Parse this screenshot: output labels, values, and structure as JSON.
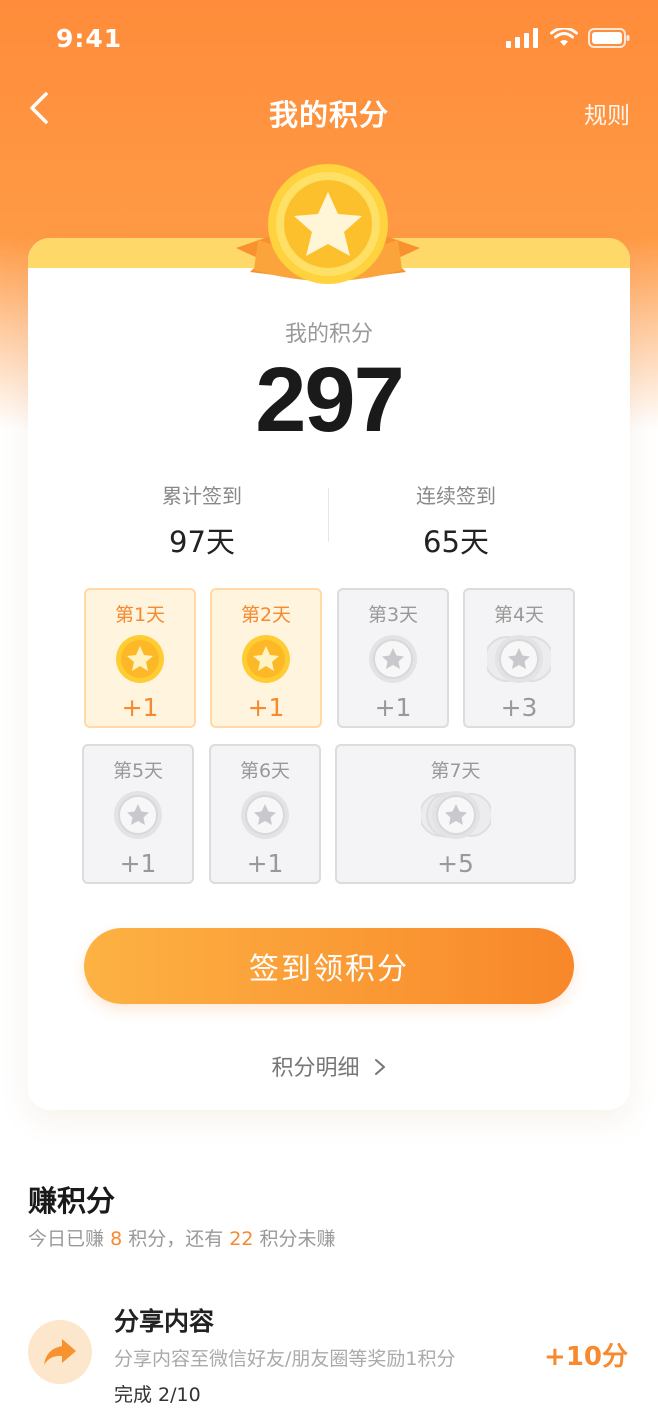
{
  "status_bar": {
    "time": "9:41"
  },
  "nav": {
    "title": "我的积分",
    "rules": "规则"
  },
  "points": {
    "label": "我的积分",
    "value": "297"
  },
  "stats": [
    {
      "label": "累计签到",
      "value": "97天"
    },
    {
      "label": "连续签到",
      "value": "65天"
    }
  ],
  "days": [
    {
      "label": "第1天",
      "bonus": "+1",
      "done": true
    },
    {
      "label": "第2天",
      "bonus": "+1",
      "done": true
    },
    {
      "label": "第3天",
      "bonus": "+1",
      "done": false
    },
    {
      "label": "第4天",
      "bonus": "+3",
      "done": false
    },
    {
      "label": "第5天",
      "bonus": "+1",
      "done": false
    },
    {
      "label": "第6天",
      "bonus": "+1",
      "done": false
    },
    {
      "label": "第7天",
      "bonus": "+5",
      "done": false
    }
  ],
  "signin_button": "签到领积分",
  "details_link": "积分明细",
  "earn": {
    "title": "赚积分",
    "sub_prefix": "今日已赚",
    "earned": "8",
    "sub_middle": "积分，还有",
    "remaining": "22",
    "sub_suffix": "积分未赚"
  },
  "task": {
    "title": "分享内容",
    "desc": "分享内容至微信好友/朋友圈等奖励1积分",
    "progress": "完成 2/10",
    "reward": "+10分",
    "icon": "share-icon"
  },
  "colors": {
    "accent": "#f7892e",
    "header": "#ff8c3a",
    "band": "#ffd86a"
  }
}
